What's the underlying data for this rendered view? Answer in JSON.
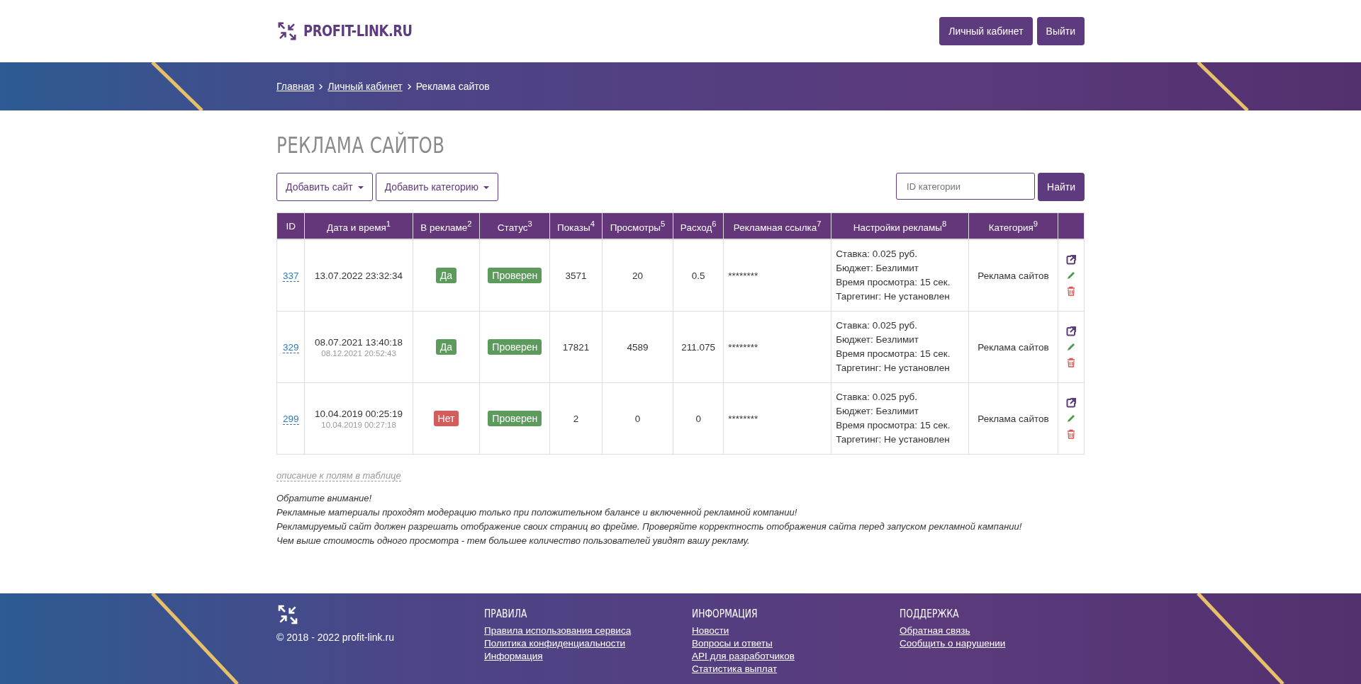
{
  "header": {
    "logo": "PROFIT-LINK.RU",
    "buttons": [
      "Личный кабинет",
      "Выйти"
    ]
  },
  "breadcrumbs": [
    {
      "label": "Главная",
      "link": true
    },
    {
      "label": "Личный кабинет",
      "link": true
    },
    {
      "label": "Реклама сайтов",
      "link": false
    }
  ],
  "page_title": "РЕКЛАМА САЙТОВ",
  "toolbar": {
    "dropdowns": [
      "Добавить сайт",
      "Добавить категорию"
    ],
    "search": {
      "placeholder": "ID категории"
    },
    "search_button": "Найти"
  },
  "table": {
    "columns": [
      "ID",
      "Дата и время$^{1}$",
      "В рекламе$^{2}$",
      "Статус$^{3}$",
      "Показы$^{4}$",
      "Просмотры$^{5}$",
      "Расход$^{6}$",
      "Рекламная ссылка$^{7}$",
      "Настройки рекламы$^{8}$",
      "Категория$^{9}$"
    ],
    "rows": [
      {
        "id": "337",
        "date": "13.07.2022 23:32:34",
        "date_sub": "",
        "in_ads": {
          "label": "Да",
          "kind": "yes"
        },
        "status": "Проверен",
        "shows": "3571",
        "views": "20",
        "spend": "0.5",
        "link": "********",
        "settings": [
          "Ставка: 0.025 руб.",
          "Бюджет: Безлимит",
          "Время просмотра: 15 сек.",
          "Таргетинг: Не установлен"
        ],
        "category": "Реклама сайтов"
      },
      {
        "id": "329",
        "date": "08.07.2021 13:40:18",
        "date_sub": "08.12.2021 20:52:43",
        "in_ads": {
          "label": "Да",
          "kind": "yes"
        },
        "status": "Проверен",
        "shows": "17821",
        "views": "4589",
        "spend": "211.075",
        "link": "********",
        "settings": [
          "Ставка: 0.025 руб.",
          "Бюджет: Безлимит",
          "Время просмотра: 15 сек.",
          "Таргетинг: Не установлен"
        ],
        "category": "Реклама сайтов"
      },
      {
        "id": "299",
        "date": "10.04.2019 00:25:19",
        "date_sub": "10.04.2019 00:27:18",
        "in_ads": {
          "label": "Нет",
          "kind": "no"
        },
        "status": "Проверен",
        "shows": "2",
        "views": "0",
        "spend": "0",
        "link": "********",
        "settings": [
          "Ставка: 0.025 руб.",
          "Бюджет: Безлимит",
          "Время просмотра: 15 сек.",
          "Таргетинг: Не установлен"
        ],
        "category": "Реклама сайтов"
      }
    ]
  },
  "fields_description_link": "описание к полям в таблице",
  "notes": [
    "Обратите внимание!",
    "Рекламные материалы проходят модерацию только при положительном балансе и включенной рекламной компании!",
    "Рекламируемый сайт должен разрешать отображение своих страниц во фрейме. Проверяйте корректность отображения сайта перед запуском рекламной кампании!",
    "Чем выше стоимость одного просмотра - тем большее количество пользователей увидят вашу рекламу."
  ],
  "footer": {
    "copyright": "© 2018 - 2022 profit-link.ru",
    "columns": [
      {
        "title": "ПРАВИЛА",
        "links": [
          "Правила использования сервиса",
          "Политика конфиденциальности",
          "Информация"
        ]
      },
      {
        "title": "ИНФОРМАЦИЯ",
        "links": [
          "Новости",
          "Вопросы и ответы",
          "API для разработчиков",
          "Статистика выплат"
        ]
      },
      {
        "title": "ПОДДЕРЖКА",
        "links": [
          "Обратная связь",
          "Сообщить о нарушении"
        ]
      }
    ]
  }
}
